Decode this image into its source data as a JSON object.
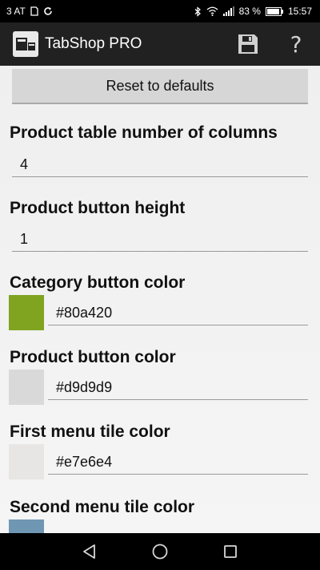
{
  "status_bar": {
    "carrier": "3 AT",
    "battery_percent": "83 %",
    "time": "15:57"
  },
  "action_bar": {
    "title": "TabShop PRO",
    "save_icon": "floppy-disk-icon",
    "help_icon": "question-mark-icon",
    "help_glyph": "?"
  },
  "settings": {
    "reset_label": "Reset to defaults",
    "columns": {
      "label": "Product table number of columns",
      "value": "4"
    },
    "button_height": {
      "label": "Product button height",
      "value": "1"
    },
    "category_color": {
      "label": "Category button color",
      "value": "#80a420",
      "swatch": "#80a420"
    },
    "product_color": {
      "label": "Product button color",
      "value": "#d9d9d9",
      "swatch": "#d9d9d9"
    },
    "first_tile_color": {
      "label": "First menu tile color",
      "value": "#e7e6e4",
      "swatch": "#e7e6e4"
    },
    "second_tile_color": {
      "label": "Second menu tile color",
      "swatch": "#6f97b3"
    }
  },
  "nav_bar": {
    "back_icon": "back-triangle-icon",
    "home_icon": "home-circle-icon",
    "recents_icon": "recents-square-icon"
  }
}
